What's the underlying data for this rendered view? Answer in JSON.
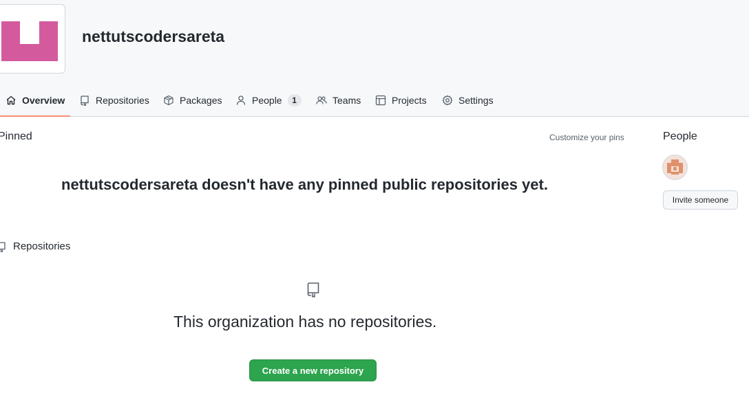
{
  "org": {
    "name": "nettutscodersareta",
    "avatar_color": "#d45a9e"
  },
  "tabs": [
    {
      "label": "Overview",
      "icon": "home-icon",
      "selected": true
    },
    {
      "label": "Repositories",
      "icon": "repo-icon"
    },
    {
      "label": "Packages",
      "icon": "package-icon"
    },
    {
      "label": "People",
      "icon": "person-icon",
      "count": "1"
    },
    {
      "label": "Teams",
      "icon": "people-icon"
    },
    {
      "label": "Projects",
      "icon": "table-icon"
    },
    {
      "label": "Settings",
      "icon": "gear-icon"
    }
  ],
  "pinned": {
    "title": "Pinned",
    "customize_label": "Customize your pins",
    "empty_message": "nettutscodersareta doesn't have any pinned public repositories yet."
  },
  "people": {
    "title": "People",
    "invite_label": "Invite someone",
    "member_avatar_color": "#e0916b"
  },
  "repositories": {
    "title": "Repositories",
    "empty_message": "This organization has no repositories.",
    "create_label": "Create a new repository"
  },
  "colors": {
    "accent_underline": "#fd8c73",
    "primary_button": "#2da44e"
  }
}
